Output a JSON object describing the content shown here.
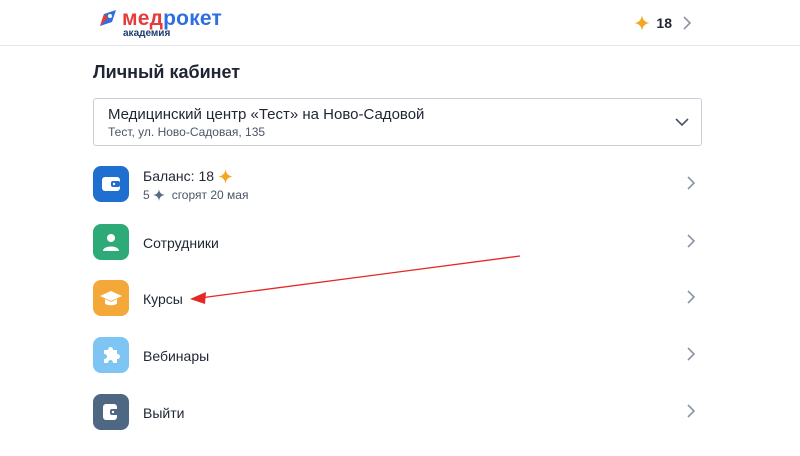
{
  "header": {
    "logo_part1": "мед",
    "logo_part2": "рокет",
    "logo_sub": "академия",
    "balance": "18"
  },
  "page": {
    "title": "Личный кабинет"
  },
  "clinic_select": {
    "name": "Медицинский центр «Тест» на Ново-Садовой",
    "address": "Тест, ул. Ново-Садовая, 135"
  },
  "menu": {
    "balance": {
      "label": "Баланс: 18",
      "expiring_amount": "5",
      "expiring_text": "сгорят 20 мая"
    },
    "staff": {
      "label": "Сотрудники"
    },
    "courses": {
      "label": "Курсы"
    },
    "webinars": {
      "label": "Вебинары"
    },
    "logout": {
      "label": "Выйти"
    }
  },
  "colors": {
    "balance_icon": "#1f6fd1",
    "staff_icon": "#2eaa78",
    "courses_icon": "#f5a83a",
    "webinars_icon": "#7ec5f3",
    "logout_icon": "#4e6783",
    "star": "#f5a623",
    "annotation_arrow": "#e52727"
  }
}
